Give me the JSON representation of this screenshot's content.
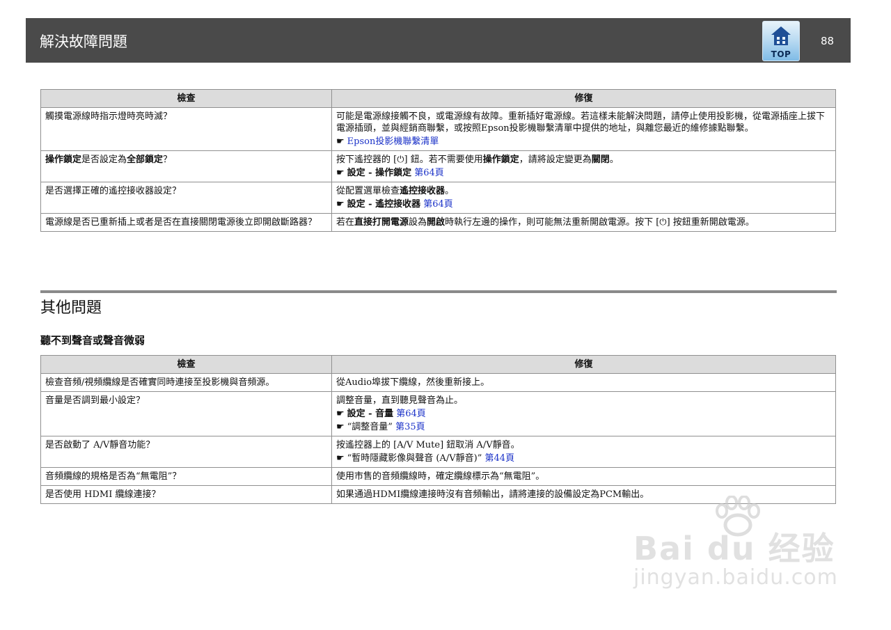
{
  "header": {
    "title": "解決故障問題",
    "top_label": "TOP",
    "page_number": "88"
  },
  "table1": {
    "col_check": "檢查",
    "col_fix": "修復",
    "rows": [
      {
        "check": "觸摸電源線時指示燈時亮時滅？",
        "fix_lines": [
          "可能是電源線接觸不良，或電源線有故障。重新插好電源線。若這樣未能解決問題，請停止使用投影機，從電源插座上拔下電源插頭，並與經銷商聯繫，或按照Epson投影機聯繫清單中提供的地址，與離您最近的維修據點聯繫。"
        ],
        "ref_link": "Epson投影機聯繫清單"
      },
      {
        "check_b1": "操作鎖定",
        "check_t1": "是否設定為",
        "check_b2": "全部鎖定",
        "check_t2": "？",
        "fix_t1": "按下遙控器的 [",
        "fix_power": "⏻",
        "fix_t2": "] 鈕。若不需要使用",
        "fix_b1": "操作鎖定",
        "fix_t3": "，請將設定變更為",
        "fix_b2": "關閉",
        "fix_t4": "。",
        "ref_b": "設定 - 操作鎖定",
        "ref_link": "第64頁"
      },
      {
        "check": "是否選擇正確的遙控接收器設定？",
        "fix_t1": "從配置選單檢查",
        "fix_b1": "遙控接收器",
        "fix_t2": "。",
        "ref_b": "設定 - 遙控接收器",
        "ref_link": "第64頁"
      },
      {
        "check": "電源線是否已重新插上或者是否在直接關閉電源後立即開啟斷路器？",
        "fix_t1": "若在",
        "fix_b1": "直接打開電源",
        "fix_t2": "設為",
        "fix_b2": "開啟",
        "fix_t3": "時執行左邊的操作，則可能無法重新開啟電源。按下 [",
        "fix_power": "⏻",
        "fix_t4": "] 按鈕重新開啟電源。"
      }
    ]
  },
  "section": {
    "title": "其他問題",
    "subtitle": "聽不到聲音或聲音微弱"
  },
  "table2": {
    "col_check": "檢查",
    "col_fix": "修復",
    "rows": [
      {
        "check": "檢查音頻/視頻纜線是否確實同時連接至投影機與音頻源。",
        "fix": "從Audio埠拔下纜線，然後重新接上。"
      },
      {
        "check": "音量是否調到最小設定？",
        "fix": "調整音量，直到聽見聲音為止。",
        "ref1_b": "設定 - 音量",
        "ref1_link": "第64頁",
        "ref2_t": "“調整音量”",
        "ref2_link": "第35頁"
      },
      {
        "check": "是否啟動了 A/V靜音功能？",
        "fix": "按遙控器上的 [A/V Mute] 鈕取消 A/V靜音。",
        "ref_t": "“暫時隱藏影像與聲音 (A/V靜音)”",
        "ref_link": "第44頁"
      },
      {
        "check": "音頻纜線的規格是否為“無電阻”？",
        "fix": "使用市售的音頻纜線時，確定纜線標示為“無電阻”。"
      },
      {
        "check": "是否使用 HDMI 纜線連接？",
        "fix": "如果通過HDMI纜線連接時沒有音頻輸出，請將連接的設備設定為PCM輸出。"
      }
    ]
  },
  "watermark": {
    "brand": "Bai du 经验",
    "url": "jingyan.baidu.com"
  }
}
